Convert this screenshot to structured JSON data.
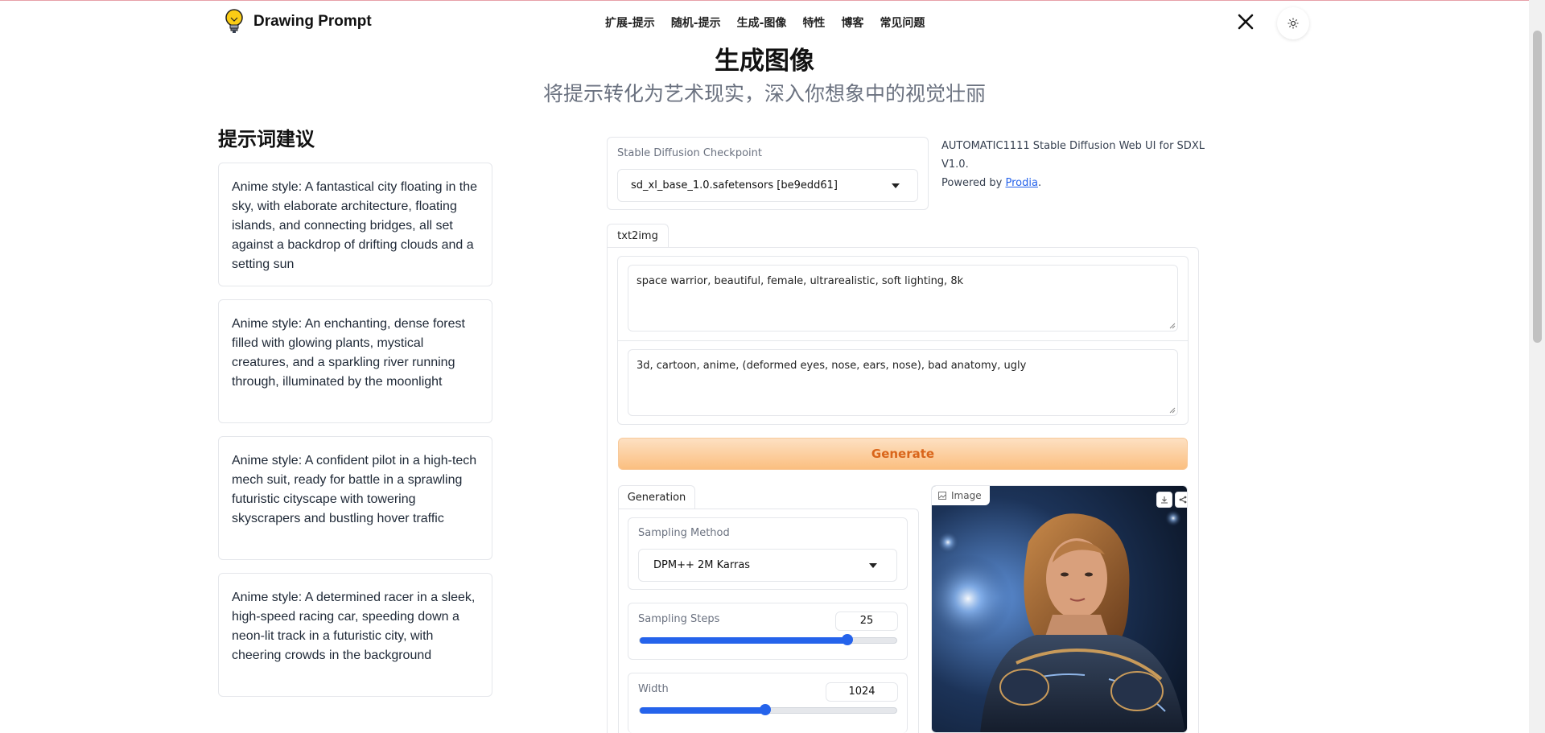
{
  "brand": {
    "name": "Drawing Prompt"
  },
  "nav": {
    "items": [
      "扩展-提示",
      "随机-提示",
      "生成-图像",
      "特性",
      "博客",
      "常见问题"
    ]
  },
  "header": {
    "title": "生成图像",
    "subtitle": "将提示转化为艺术现实，深入你想象中的视觉壮丽"
  },
  "suggestions": {
    "heading": "提示词建议",
    "items": [
      "Anime style: A fantastical city floating in the sky, with elaborate architecture, floating islands, and connecting bridges, all set against a backdrop of drifting clouds and a setting sun",
      "Anime style: An enchanting, dense forest filled with glowing plants, mystical creatures, and a sparkling river running through, illuminated by the moonlight",
      "Anime style: A confident pilot in a high-tech mech suit, ready for battle in a sprawling futuristic cityscape with towering skyscrapers and bustling hover traffic",
      "Anime style: A determined racer in a sleek, high-speed racing car, speeding down a neon-lit track in a futuristic city, with cheering crowds in the background"
    ]
  },
  "checkpoint": {
    "label": "Stable Diffusion Checkpoint",
    "value": "sd_xl_base_1.0.safetensors [be9edd61]"
  },
  "info": {
    "line1": "AUTOMATIC1111 Stable Diffusion Web UI for SDXL V1.0.",
    "powered_prefix": "Powered by ",
    "powered_link": "Prodia",
    "powered_suffix": "."
  },
  "tabs": {
    "main": "txt2img",
    "generation": "Generation"
  },
  "prompt": {
    "positive": "space warrior, beautiful, female, ultrarealistic, soft lighting, 8k",
    "negative": "3d, cartoon, anime, (deformed eyes, nose, ears, nose), bad anatomy, ugly"
  },
  "generate": {
    "label": "Generate"
  },
  "sampling_method": {
    "label": "Sampling Method",
    "value": "DPM++ 2M Karras"
  },
  "sampling_steps": {
    "label": "Sampling Steps",
    "value": "25",
    "fraction": 0.81
  },
  "width": {
    "label": "Width",
    "value": "1024",
    "fraction": 0.49
  },
  "image": {
    "label": "Image"
  },
  "colors": {
    "accent": "#2563eb",
    "generate_text": "#d9651a",
    "generate_bg": "#fbbf80"
  }
}
